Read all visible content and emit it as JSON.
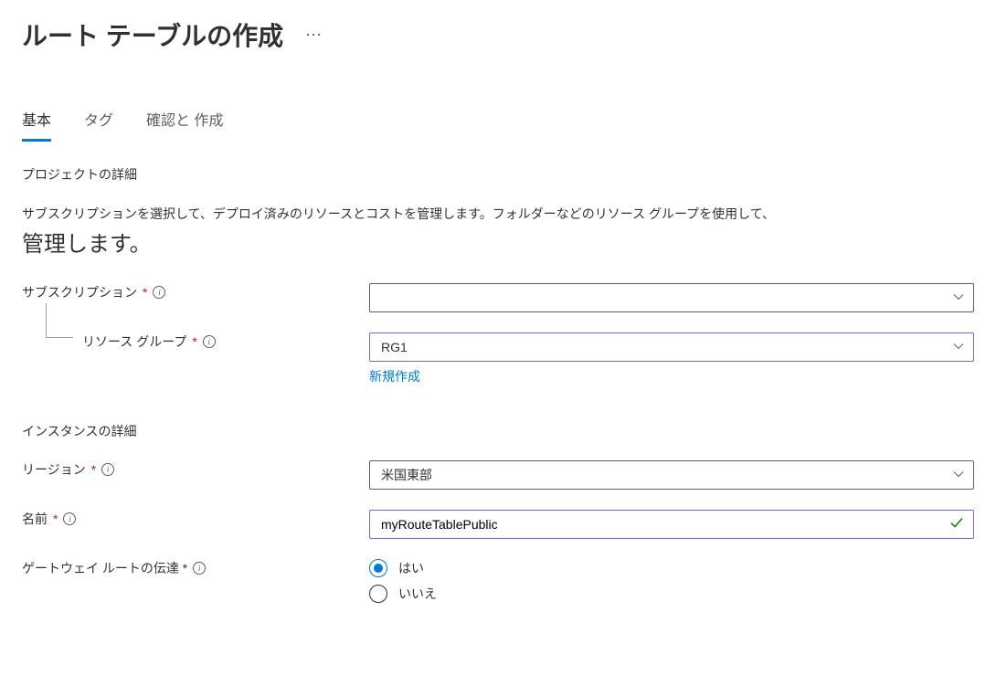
{
  "header": {
    "title": "ルート テーブルの作成"
  },
  "tabs": [
    {
      "label": "基本",
      "active": true
    },
    {
      "label": "タグ",
      "active": false
    },
    {
      "label": "確認と 作成",
      "active": false
    }
  ],
  "sections": {
    "project": {
      "title": "プロジェクトの詳細",
      "desc_line1": "サブスクリプションを選択して、デプロイ済みのリソースとコストを管理します。フォルダーなどのリソース グループを使用して、",
      "desc_line2": "管理します。"
    },
    "instance": {
      "title": "インスタンスの詳細"
    }
  },
  "fields": {
    "subscription": {
      "label": "サブスクリプション",
      "value": ""
    },
    "resource_group": {
      "label": "リソース グループ",
      "value": "RG1",
      "create_new": "新規作成"
    },
    "region": {
      "label": "リージョン",
      "value": "米国東部"
    },
    "name": {
      "label": "名前",
      "value": "myRouteTablePublic"
    },
    "gateway_route": {
      "label": "ゲートウェイ ルートの伝達 *",
      "options": {
        "yes": "はい",
        "no": "いいえ"
      },
      "selected": "yes"
    }
  }
}
